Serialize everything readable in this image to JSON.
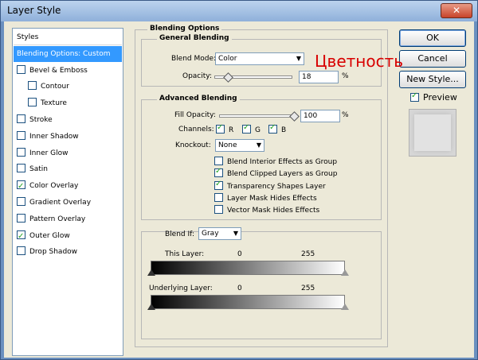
{
  "window": {
    "title": "Layer Style",
    "close_glyph": "✕"
  },
  "styles_list": {
    "items": [
      {
        "label": "Styles",
        "type": "header"
      },
      {
        "label": "Blending Options: Custom",
        "type": "selected"
      },
      {
        "label": "Bevel & Emboss",
        "checked": false,
        "indent": 0
      },
      {
        "label": "Contour",
        "checked": false,
        "indent": 1
      },
      {
        "label": "Texture",
        "checked": false,
        "indent": 1
      },
      {
        "label": "Stroke",
        "checked": false,
        "indent": 0
      },
      {
        "label": "Inner Shadow",
        "checked": false,
        "indent": 0
      },
      {
        "label": "Inner Glow",
        "checked": false,
        "indent": 0
      },
      {
        "label": "Satin",
        "checked": false,
        "indent": 0
      },
      {
        "label": "Color Overlay",
        "checked": true,
        "indent": 0
      },
      {
        "label": "Gradient Overlay",
        "checked": false,
        "indent": 0
      },
      {
        "label": "Pattern Overlay",
        "checked": false,
        "indent": 0
      },
      {
        "label": "Outer Glow",
        "checked": true,
        "indent": 0
      },
      {
        "label": "Drop Shadow",
        "checked": false,
        "indent": 0
      }
    ]
  },
  "blending": {
    "section_title": "Blending Options",
    "general_title": "General Blending",
    "blend_mode_label": "Blend Mode:",
    "blend_mode_value": "Color",
    "opacity_label": "Opacity:",
    "opacity_value": "18",
    "opacity_fraction": 0.18,
    "percent": "%",
    "advanced_title": "Advanced Blending",
    "fill_opacity_label": "Fill Opacity:",
    "fill_opacity_value": "100",
    "fill_opacity_fraction": 1.0,
    "channels_label": "Channels:",
    "channels": [
      {
        "label": "R",
        "checked": true
      },
      {
        "label": "G",
        "checked": true
      },
      {
        "label": "B",
        "checked": true
      }
    ],
    "knockout_label": "Knockout:",
    "knockout_value": "None",
    "options": [
      {
        "label": "Blend Interior Effects as Group",
        "checked": false
      },
      {
        "label": "Blend Clipped Layers as Group",
        "checked": true
      },
      {
        "label": "Transparency Shapes Layer",
        "checked": true
      },
      {
        "label": "Layer Mask Hides Effects",
        "checked": false
      },
      {
        "label": "Vector Mask Hides Effects",
        "checked": false
      }
    ],
    "blend_if_label": "Blend If:",
    "blend_if_value": "Gray",
    "this_layer_label": "This Layer:",
    "this_layer_min": "0",
    "this_layer_max": "255",
    "underlying_label": "Underlying Layer:",
    "underlying_min": "0",
    "underlying_max": "255"
  },
  "buttons": {
    "ok": "OK",
    "cancel": "Cancel",
    "new_style": "New Style...",
    "preview_label": "Preview",
    "preview_checked": true
  },
  "annotation": {
    "text": "Цветность",
    "color": "#d80000"
  }
}
